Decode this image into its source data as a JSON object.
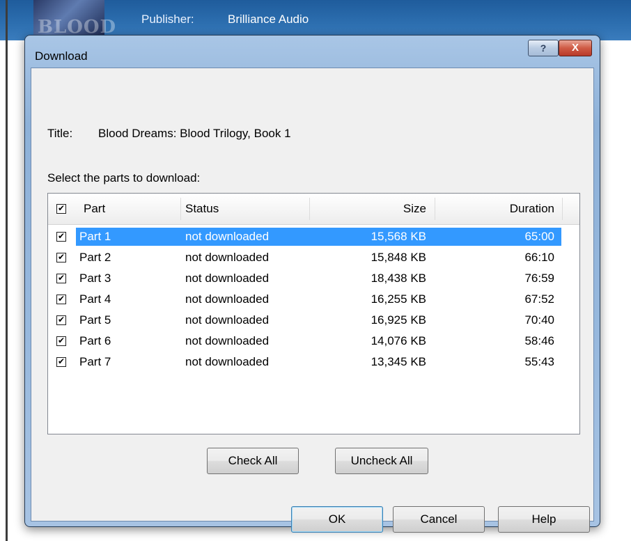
{
  "background_app": {
    "cover_text": "BLOOD",
    "publisher_label": "Publisher:",
    "publisher_value": "Brilliance Audio"
  },
  "dialog": {
    "title": "Download",
    "title_buttons": {
      "help": "?",
      "close": "X"
    },
    "book_title_label": "Title:",
    "book_title_value": "Blood Dreams: Blood Trilogy, Book 1",
    "select_prompt": "Select the parts to download:",
    "list": {
      "header_all_checked": true,
      "columns": [
        "Part",
        "Status",
        "Size",
        "Duration"
      ],
      "rows": [
        {
          "part": "Part 1",
          "status": "not downloaded",
          "size": "15,568 KB",
          "duration": "65:00",
          "checked": true,
          "selected": true
        },
        {
          "part": "Part 2",
          "status": "not downloaded",
          "size": "15,848 KB",
          "duration": "66:10",
          "checked": true,
          "selected": false
        },
        {
          "part": "Part 3",
          "status": "not downloaded",
          "size": "18,438 KB",
          "duration": "76:59",
          "checked": true,
          "selected": false
        },
        {
          "part": "Part 4",
          "status": "not downloaded",
          "size": "16,255 KB",
          "duration": "67:52",
          "checked": true,
          "selected": false
        },
        {
          "part": "Part 5",
          "status": "not downloaded",
          "size": "16,925 KB",
          "duration": "70:40",
          "checked": true,
          "selected": false
        },
        {
          "part": "Part 6",
          "status": "not downloaded",
          "size": "14,076 KB",
          "duration": "58:46",
          "checked": true,
          "selected": false
        },
        {
          "part": "Part 7",
          "status": "not downloaded",
          "size": "13,345 KB",
          "duration": "55:43",
          "checked": true,
          "selected": false
        }
      ]
    },
    "buttons": {
      "check_all": "Check All",
      "uncheck_all": "Uncheck All",
      "ok": "OK",
      "cancel": "Cancel",
      "help": "Help"
    }
  },
  "colors": {
    "selection": "#3399ff",
    "title_bar": "#97b8dd",
    "close_button": "#cf5b45"
  }
}
